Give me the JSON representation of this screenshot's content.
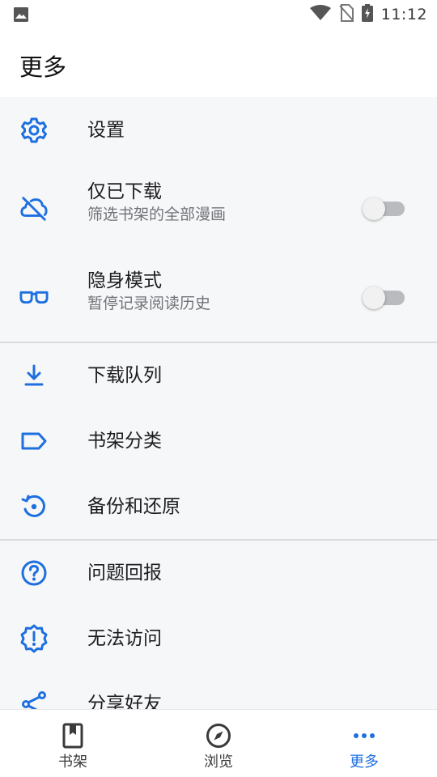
{
  "status_bar": {
    "time": "11:12",
    "icons": [
      "image-icon",
      "wifi-icon",
      "no-sim-icon",
      "battery-charging-icon"
    ]
  },
  "header": {
    "title": "更多"
  },
  "colors": {
    "accent": "#1e6fe0",
    "background": "#f6f7f8",
    "toggle_off": "#b9bbbf"
  },
  "menu": {
    "settings": {
      "icon": "gear-icon",
      "title": "设置"
    },
    "downloaded_only": {
      "icon": "cloud-off-icon",
      "title": "仅已下载",
      "subtitle": "筛选书架的全部漫画",
      "enabled": false
    },
    "incognito": {
      "icon": "glasses-icon",
      "title": "隐身模式",
      "subtitle": "暂停记录阅读历史",
      "enabled": false
    },
    "download_queue": {
      "icon": "download-icon",
      "title": "下载队列"
    },
    "categories": {
      "icon": "label-icon",
      "title": "书架分类"
    },
    "backup": {
      "icon": "restore-icon",
      "title": "备份和还原"
    },
    "feedback": {
      "icon": "help-icon",
      "title": "问题回报"
    },
    "no_access": {
      "icon": "alert-badge-icon",
      "title": "无法访问"
    },
    "share": {
      "icon": "share-icon",
      "title": "分享好友"
    }
  },
  "bottom_nav": {
    "tabs": [
      {
        "label": "书架",
        "icon": "bookmark-book-icon",
        "active": false
      },
      {
        "label": "浏览",
        "icon": "compass-icon",
        "active": false
      },
      {
        "label": "更多",
        "icon": "more-dots-icon",
        "active": true
      }
    ]
  }
}
